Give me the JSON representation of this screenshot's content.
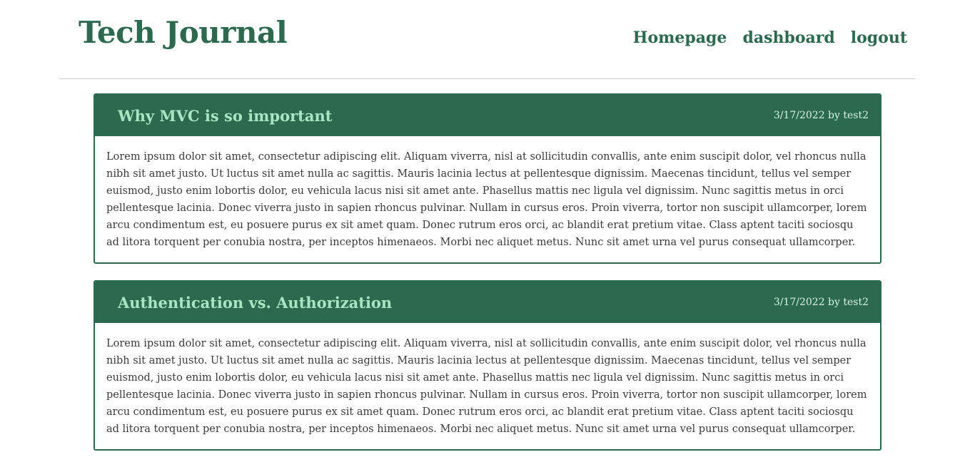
{
  "site": {
    "title": "Tech Journal"
  },
  "nav": {
    "items": [
      {
        "label": "Homepage"
      },
      {
        "label": "dashboard"
      },
      {
        "label": "logout"
      }
    ]
  },
  "posts": [
    {
      "title": "Why MVC is so important",
      "meta": "3/17/2022 by test2",
      "body": "Lorem ipsum dolor sit amet, consectetur adipiscing elit. Aliquam viverra, nisl at sollicitudin convallis, ante enim suscipit dolor, vel rhoncus nulla nibh sit amet justo. Ut luctus sit amet nulla ac sagittis. Mauris lacinia lectus at pellentesque dignissim. Maecenas tincidunt, tellus vel semper euismod, justo enim lobortis dolor, eu vehicula lacus nisi sit amet ante. Phasellus mattis nec ligula vel dignissim. Nunc sagittis metus in orci pellentesque lacinia. Donec viverra justo in sapien rhoncus pulvinar. Nullam in cursus eros. Proin viverra, tortor non suscipit ullamcorper, lorem arcu condimentum est, eu posuere purus ex sit amet quam. Donec rutrum eros orci, ac blandit erat pretium vitae. Class aptent taciti sociosqu ad litora torquent per conubia nostra, per inceptos himenaeos. Morbi nec aliquet metus. Nunc sit amet urna vel purus consequat ullamcorper."
    },
    {
      "title": "Authentication vs. Authorization",
      "meta": "3/17/2022 by test2",
      "body": "Lorem ipsum dolor sit amet, consectetur adipiscing elit. Aliquam viverra, nisl at sollicitudin convallis, ante enim suscipit dolor, vel rhoncus nulla nibh sit amet justo. Ut luctus sit amet nulla ac sagittis. Mauris lacinia lectus at pellentesque dignissim. Maecenas tincidunt, tellus vel semper euismod, justo enim lobortis dolor, eu vehicula lacus nisi sit amet ante. Phasellus mattis nec ligula vel dignissim. Nunc sagittis metus in orci pellentesque lacinia. Donec viverra justo in sapien rhoncus pulvinar. Nullam in cursus eros. Proin viverra, tortor non suscipit ullamcorper, lorem arcu condimentum est, eu posuere purus ex sit amet quam. Donec rutrum eros orci, ac blandit erat pretium vitae. Class aptent taciti sociosqu ad litora torquent per conubia nostra, per inceptos himenaeos. Morbi nec aliquet metus. Nunc sit amet urna vel purus consequat ullamcorper."
    }
  ],
  "colors": {
    "brand": "#2c6a50",
    "title_accent": "#a8e6c3"
  }
}
